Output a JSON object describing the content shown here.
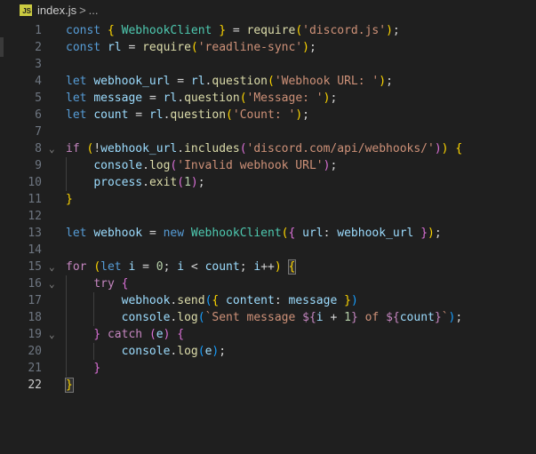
{
  "breadcrumb": {
    "file_icon": "JS",
    "file_name": "index.js",
    "separator": ">",
    "more": "..."
  },
  "editor": {
    "language": "javascript",
    "active_line": 22,
    "lines": [
      {
        "n": "1",
        "fold": false
      },
      {
        "n": "2",
        "fold": false
      },
      {
        "n": "3",
        "fold": false
      },
      {
        "n": "4",
        "fold": false
      },
      {
        "n": "5",
        "fold": false
      },
      {
        "n": "6",
        "fold": false
      },
      {
        "n": "7",
        "fold": false
      },
      {
        "n": "8",
        "fold": true
      },
      {
        "n": "9",
        "fold": false
      },
      {
        "n": "10",
        "fold": false
      },
      {
        "n": "11",
        "fold": false
      },
      {
        "n": "12",
        "fold": false
      },
      {
        "n": "13",
        "fold": false
      },
      {
        "n": "14",
        "fold": false
      },
      {
        "n": "15",
        "fold": true
      },
      {
        "n": "16",
        "fold": true
      },
      {
        "n": "17",
        "fold": false
      },
      {
        "n": "18",
        "fold": false
      },
      {
        "n": "19",
        "fold": true
      },
      {
        "n": "20",
        "fold": false
      },
      {
        "n": "21",
        "fold": false
      },
      {
        "n": "22",
        "fold": false
      }
    ],
    "code": [
      "const { WebhookClient } = require('discord.js');",
      "const rl = require('readline-sync');",
      "",
      "let webhook_url = rl.question('Webhook URL: ');",
      "let message = rl.question('Message: ');",
      "let count = rl.question('Count: ');",
      "",
      "if (!webhook_url.includes('discord.com/api/webhooks/')) {",
      "    console.log('Invalid webhook URL');",
      "    process.exit(1);",
      "}",
      "",
      "let webhook = new WebhookClient({ url: webhook_url });",
      "",
      "for (let i = 0; i < count; i++) {",
      "    try {",
      "        webhook.send({ content: message })",
      "        console.log(`Sent message ${i + 1} of ${count}`);",
      "    } catch (e) {",
      "        console.log(e);",
      "    }",
      "}"
    ],
    "fold_glyph": "⌄"
  },
  "colors": {
    "background": "#1f1f1f",
    "keyword": "#569cd6",
    "control": "#c586c0",
    "variable": "#9cdcfe",
    "class": "#4ec9b0",
    "function": "#dcdcaa",
    "string": "#ce9178",
    "number": "#b5cea8"
  }
}
